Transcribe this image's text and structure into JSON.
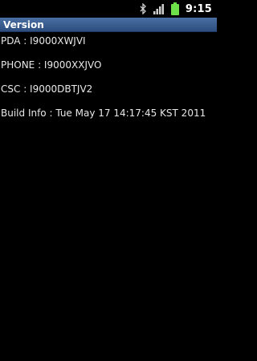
{
  "status_bar": {
    "time": "9:15",
    "icons": [
      "bluetooth-icon",
      "signal-icon",
      "battery-icon"
    ],
    "battery_color": "#6ee04a"
  },
  "title_bar": {
    "title": "Version",
    "colors": {
      "top": "#4a6fa3",
      "bottom": "#2d4d7f"
    }
  },
  "info": [
    "PDA : I9000XWJVI",
    "PHONE : I9000XXJVO",
    "CSC : I9000DBTJV2",
    "Build Info : Tue May 17 14:17:45 KST 2011"
  ]
}
